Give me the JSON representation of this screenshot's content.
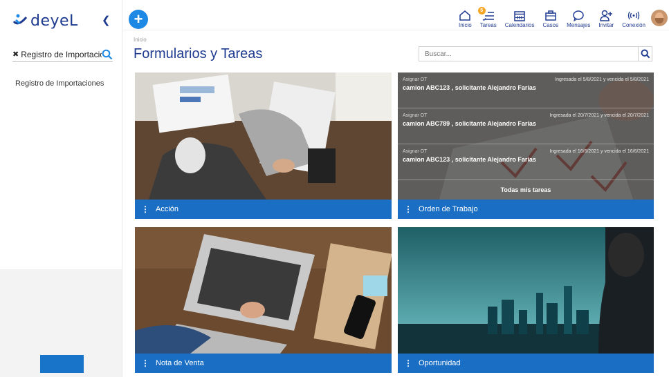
{
  "brand": {
    "logo_text": "deyeL"
  },
  "sidebar": {
    "collapse_icon": "chevron-left-icon",
    "search_chip": {
      "text": "Registro de Importaciones",
      "clear_icon": "close-icon",
      "search_icon": "search-icon"
    },
    "items": [
      {
        "label": "Registro de Importaciones"
      }
    ]
  },
  "topbar": {
    "add_icon": "plus-icon",
    "nav": [
      {
        "label": "Inicio",
        "icon": "home-icon"
      },
      {
        "label": "Tareas",
        "icon": "tasks-icon",
        "badge": "5"
      },
      {
        "label": "Calendarios",
        "icon": "calendar-icon"
      },
      {
        "label": "Casos",
        "icon": "briefcase-icon"
      },
      {
        "label": "Mensajes",
        "icon": "chat-icon"
      },
      {
        "label": "Invitar",
        "icon": "add-user-icon"
      },
      {
        "label": "Conexión",
        "icon": "signal-icon"
      }
    ]
  },
  "main": {
    "breadcrumb": "Inicio",
    "title": "Formularios y Tareas",
    "search": {
      "placeholder": "Buscar...",
      "value": ""
    },
    "cards": [
      {
        "label": "Acción"
      },
      {
        "label": "Orden de Trabajo"
      },
      {
        "label": "Nota de Venta"
      },
      {
        "label": "Oportunidad"
      }
    ],
    "tasks": [
      {
        "type": "Asignar OT",
        "date": "Ingresada el 5/8/2021 y vencida el 5/8/2021",
        "title": "camion ABC123 , solicitante Alejandro Farías"
      },
      {
        "type": "Asignar OT",
        "date": "Ingresada el 20/7/2021 y vencida el 20/7/2021",
        "title": "camion ABC789 , solicitante Alejandro Farías"
      },
      {
        "type": "Asignar OT",
        "date": "Ingresada el 16/6/2021 y vencida el 16/6/2021",
        "title": "camion ABC123 , solicitante Alejandro Farías"
      }
    ],
    "all_tasks_label": "Todas mis tareas"
  },
  "colors": {
    "brand_blue": "#1f3b8f",
    "bar_blue": "#1a6fc4",
    "accent": "#1e88e5",
    "badge": "#f5a623"
  }
}
